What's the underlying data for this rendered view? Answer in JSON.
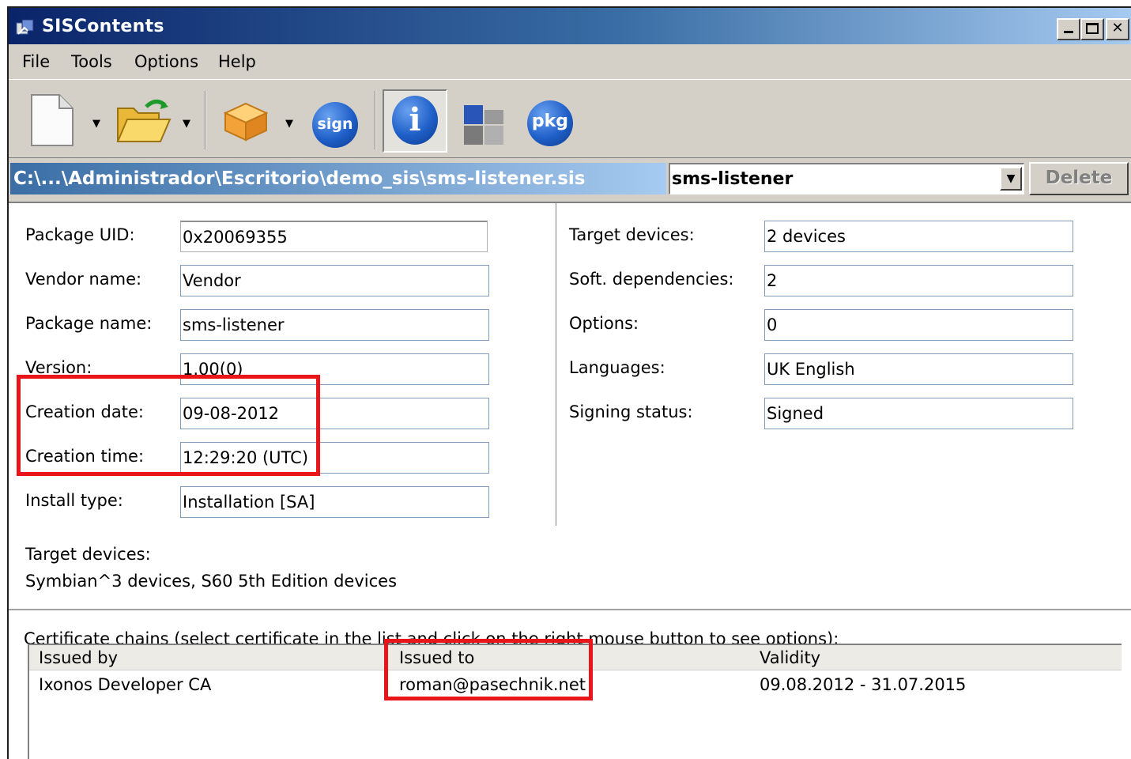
{
  "window": {
    "title": "SISContents"
  },
  "menu": [
    "File",
    "Tools",
    "Options",
    "Help"
  ],
  "toolbar": {
    "sign_label": "sign",
    "info_label": "i",
    "pkg_label": "pkg"
  },
  "pathbar": {
    "path": "C:\\...\\Administrador\\Escritorio\\demo_sis\\sms-listener.sis",
    "combo_value": "sms-listener",
    "delete_label": "Delete"
  },
  "left_fields": [
    {
      "label": "Package UID:",
      "value": "0x20069355"
    },
    {
      "label": "Vendor name:",
      "value": "Vendor"
    },
    {
      "label": "Package name:",
      "value": "sms-listener"
    },
    {
      "label": "Version:",
      "value": "1.00(0)"
    },
    {
      "label": "Creation date:",
      "value": "09-08-2012"
    },
    {
      "label": "Creation time:",
      "value": "12:29:20 (UTC)"
    },
    {
      "label": "Install type:",
      "value": "Installation [SA]"
    }
  ],
  "right_fields": [
    {
      "label": "Target devices:",
      "value": "2 devices"
    },
    {
      "label": "Soft. dependencies:",
      "value": "2"
    },
    {
      "label": "Options:",
      "value": "0"
    },
    {
      "label": "Languages:",
      "value": "UK English"
    },
    {
      "label": "Signing status:",
      "value": "Signed"
    }
  ],
  "target": {
    "label": "Target devices:",
    "value": "Symbian^3 devices, S60 5th Edition devices"
  },
  "certificates": {
    "caption": "Certificate chains (select certificate in the list and click on the right mouse button to see options):",
    "columns": [
      "Issued by",
      "Issued to",
      "Validity"
    ],
    "rows": [
      {
        "issued_by": "Ixonos Developer CA",
        "issued_to": "roman@pasechnik.net",
        "validity": "09.08.2012 - 31.07.2015"
      }
    ]
  },
  "colors": {
    "highlight": "#e8161b",
    "title_gradient_start": "#0a246a",
    "title_gradient_end": "#a6caf0"
  }
}
